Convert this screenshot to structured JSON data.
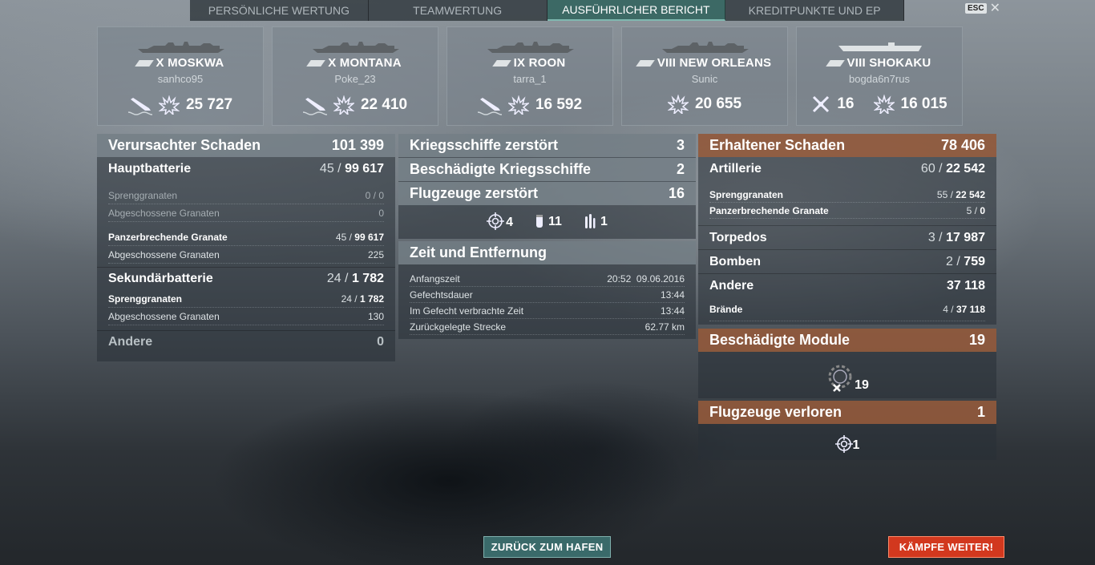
{
  "tabs": [
    {
      "label": "PERSÖNLICHE WERTUNG",
      "active": false
    },
    {
      "label": "TEAMWERTUNG",
      "active": false
    },
    {
      "label": "AUSFÜHRLICHER BERICHT",
      "active": true
    },
    {
      "label": "KREDITPUNKTE UND EP",
      "active": false
    }
  ],
  "esc_label": "ESC",
  "ships": [
    {
      "name": "X MOSKWA",
      "player": "sanhco95",
      "kills_icon": "sunk-ship-icon",
      "damage": "25 727"
    },
    {
      "name": "X MONTANA",
      "player": "Poke_23",
      "kills_icon": "sunk-ship-icon",
      "damage": "22 410"
    },
    {
      "name": "IX ROON",
      "player": "tarra_1",
      "kills_icon": "sunk-ship-icon",
      "damage": "16 592"
    },
    {
      "name": "VIII NEW ORLEANS",
      "player": "Sunic",
      "damage": "20 655"
    },
    {
      "name": "VIII SHOKAKU",
      "player": "bogda6n7rus",
      "planes": "16",
      "damage": "16 015"
    }
  ],
  "dealt": {
    "title": "Verursachter Schaden",
    "total": "101 399",
    "main": {
      "label": "Hauptbatterie",
      "hits": "45",
      "value": "99 617"
    },
    "he": {
      "label": "Sprenggranaten",
      "value": "0 / 0"
    },
    "he_fired": {
      "label": "Abgeschossene Granaten",
      "value": "0"
    },
    "ap": {
      "label": "Panzerbrechende Granate",
      "hits": "45",
      "value": "99 617"
    },
    "ap_fired": {
      "label": "Abgeschossene Granaten",
      "value": "225"
    },
    "secondary": {
      "label": "Sekundärbatterie",
      "hits": "24",
      "value": "1 782"
    },
    "sec_he": {
      "label": "Sprenggranaten",
      "hits": "24",
      "value": "1 782"
    },
    "sec_fired": {
      "label": "Abgeschossene Granaten",
      "value": "130"
    },
    "other": {
      "label": "Andere",
      "value": "0"
    }
  },
  "kills": {
    "warships": {
      "label": "Kriegsschiffe zerstört",
      "value": "3"
    },
    "damaged": {
      "label": "Beschädigte Kriegsschiffe",
      "value": "2"
    },
    "planes": {
      "label": "Flugzeuge zerstört",
      "value": "16"
    },
    "plane_types": [
      {
        "icon": "fighter-crosshair-icon",
        "value": "4"
      },
      {
        "icon": "bomb-icon",
        "value": "11"
      },
      {
        "icon": "torpedo-icon",
        "value": "1"
      }
    ]
  },
  "time": {
    "title": "Zeit und Entfernung",
    "rows": [
      {
        "label": "Anfangszeit",
        "value": "20:52  09.06.2016"
      },
      {
        "label": "Gefechtsdauer",
        "value": "13:44"
      },
      {
        "label": "Im Gefecht verbrachte Zeit",
        "value": "13:44"
      },
      {
        "label": "Zurückgelegte Strecke",
        "value": "62.77 km"
      }
    ]
  },
  "received": {
    "title": "Erhaltener Schaden",
    "total": "78 406",
    "artillery": {
      "label": "Artillerie",
      "hits": "60",
      "value": "22 542"
    },
    "he": {
      "label": "Sprenggranaten",
      "hits": "55",
      "value": "22 542"
    },
    "ap": {
      "label": "Panzerbrechende Granate",
      "hits": "5",
      "value": "0"
    },
    "torpedo": {
      "label": "Torpedos",
      "hits": "3",
      "value": "17 987"
    },
    "bombs": {
      "label": "Bomben",
      "hits": "2",
      "value": "759"
    },
    "other": {
      "label": "Andere",
      "value": "37 118"
    },
    "fires": {
      "label": "Brände",
      "hits": "4",
      "value": "37 118"
    }
  },
  "modules": {
    "title": "Beschädigte Module",
    "total": "19",
    "icon_value": "19"
  },
  "lost": {
    "title": "Flugzeuge verloren",
    "total": "1",
    "icon_value": "1"
  },
  "buttons": {
    "back": "ZURÜCK ZUM HAFEN",
    "continue": "KÄMPFE WEITER!"
  },
  "colors": {
    "accent_tab": "#3c6e69",
    "orange_header": "#a05f3c",
    "continue_btn": "#d2381e",
    "back_btn": "#3a6a6a"
  }
}
